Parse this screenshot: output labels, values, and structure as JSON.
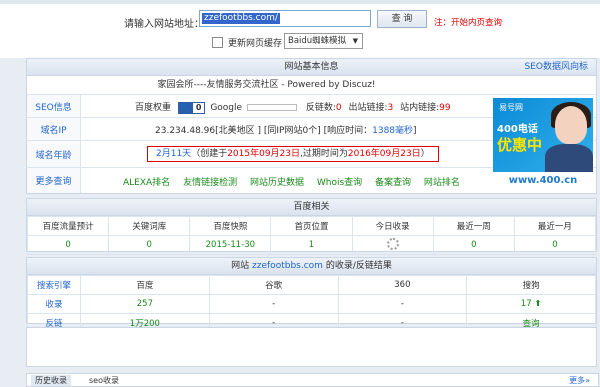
{
  "search": {
    "label": "请输入网站地址：",
    "value": "zzefootbbs.com/",
    "button": "查 询",
    "note": "注：开始内页查询",
    "cache_label": "更新网页缓存",
    "engine_select": "Baidu蜘蛛模拟"
  },
  "basic": {
    "title": "网站基本信息",
    "seo_link": "SEO数据风向标",
    "site_title": "家园会所----友情服务交流社区 - Powered by Discuz!",
    "seo_label": "SEO信息",
    "baidu_weight_label": "百度权重",
    "baidu_weight_value": "0",
    "google_label": "Google",
    "backlinks_label": "反链数:",
    "backlinks_value": "0",
    "outlinks_label": "出站链接:",
    "outlinks_value": "3",
    "inlinks_label": "站内链接:",
    "inlinks_value": "99",
    "ip_label": "域名IP",
    "ip_value": "23.234.48.96[北美地区 ]",
    "same_ip": "[同IP网站0个]",
    "response_label": "[响应时间：",
    "response_value": "1388毫秒",
    "response_end": "]",
    "age_label": "域名年龄",
    "age_value": "2月11天",
    "age_created_prefix": "（创建于",
    "created_date": "2015年09月23日",
    "age_expire_prefix": ",过期时间为",
    "expire_date": "2016年09月23日",
    "age_suffix": "）",
    "more_label": "更多查询",
    "more_links": [
      "ALEXA排名",
      "友情链接检测",
      "网站历史数据",
      "Whois查询",
      "备案查询",
      "网站排名"
    ]
  },
  "ad": {
    "brand": "易号网",
    "phone": "400电话",
    "slogan": "优惠中",
    "url": "www.400.cn"
  },
  "baidu": {
    "title": "百度相关",
    "headers": [
      "百度流量预计",
      "关键词库",
      "百度快照",
      "首页位置",
      "今日收录",
      "最近一周",
      "最近一月"
    ],
    "values": [
      "0",
      "0",
      "2015-11-30",
      "1",
      "",
      "0",
      "0"
    ]
  },
  "index": {
    "title_prefix": "网站",
    "title_domain": "zzefootbbs.com",
    "title_suffix": "的收录/反链结果",
    "headers": [
      "搜索引擎",
      "百度",
      "谷歌",
      "360",
      "搜狗"
    ],
    "rows": [
      {
        "label": "收录",
        "cells": [
          "257",
          "-",
          "-",
          "17"
        ]
      },
      {
        "label": "反链",
        "cells": [
          "1万200",
          "-",
          "-",
          "查询"
        ]
      }
    ]
  },
  "bottom": {
    "tab1": "历史收录",
    "tab2": "seo收录",
    "more": "更多»"
  }
}
